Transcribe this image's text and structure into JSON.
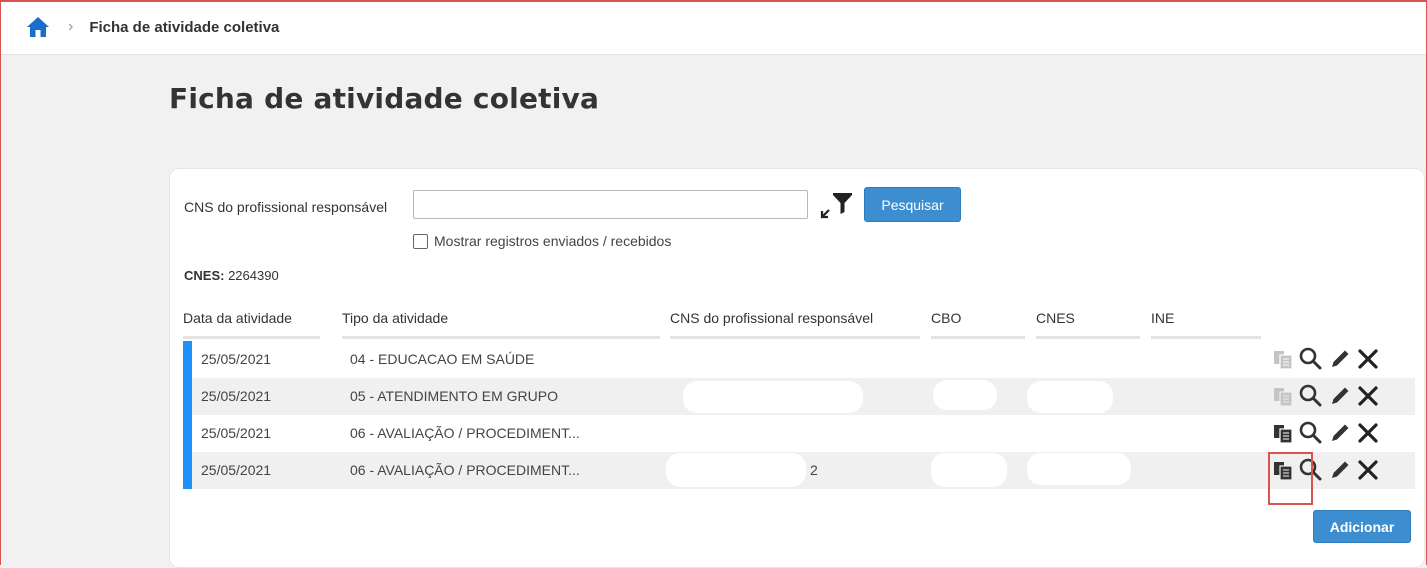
{
  "breadcrumb": {
    "current": "Ficha de atividade coletiva",
    "separator": "›"
  },
  "page": {
    "title": "Ficha de atividade coletiva"
  },
  "filter": {
    "label": "CNS do profissional responsável",
    "input_value": "",
    "search_button": "Pesquisar",
    "checkbox_label": "Mostrar registros enviados / recebidos",
    "checkbox_checked": false
  },
  "cnes": {
    "label": "CNES:",
    "value": "2264390"
  },
  "table": {
    "headers": [
      "Data da atividade",
      "Tipo da atividade",
      "CNS do profissional responsável",
      "CBO",
      "CNES",
      "INE"
    ],
    "rows": [
      {
        "date": "25/05/2021",
        "type": "04 - EDUCACAO EM SAÚDE",
        "cns": "",
        "copy_enabled": false
      },
      {
        "date": "25/05/2021",
        "type": "05 - ATENDIMENTO EM GRUPO",
        "cns": "",
        "copy_enabled": false
      },
      {
        "date": "25/05/2021",
        "type": "06 - AVALIAÇÃO / PROCEDIMENT...",
        "cns": "",
        "copy_enabled": true
      },
      {
        "date": "25/05/2021",
        "type": "06 - AVALIAÇÃO / PROCEDIMENT...",
        "cns": "2",
        "copy_enabled": true
      }
    ]
  },
  "actions": {
    "add_button": "Adicionar"
  },
  "colors": {
    "accent": "#3d8ed0",
    "row_marker": "#1e90ff",
    "highlight": "#d9534f",
    "home_icon": "#1a6ec9"
  },
  "icons": {
    "home": "home-icon",
    "filter": "funnel-icon",
    "copy": "copy-icon",
    "view": "magnifier-icon",
    "edit": "pencil-icon",
    "delete": "close-icon"
  }
}
